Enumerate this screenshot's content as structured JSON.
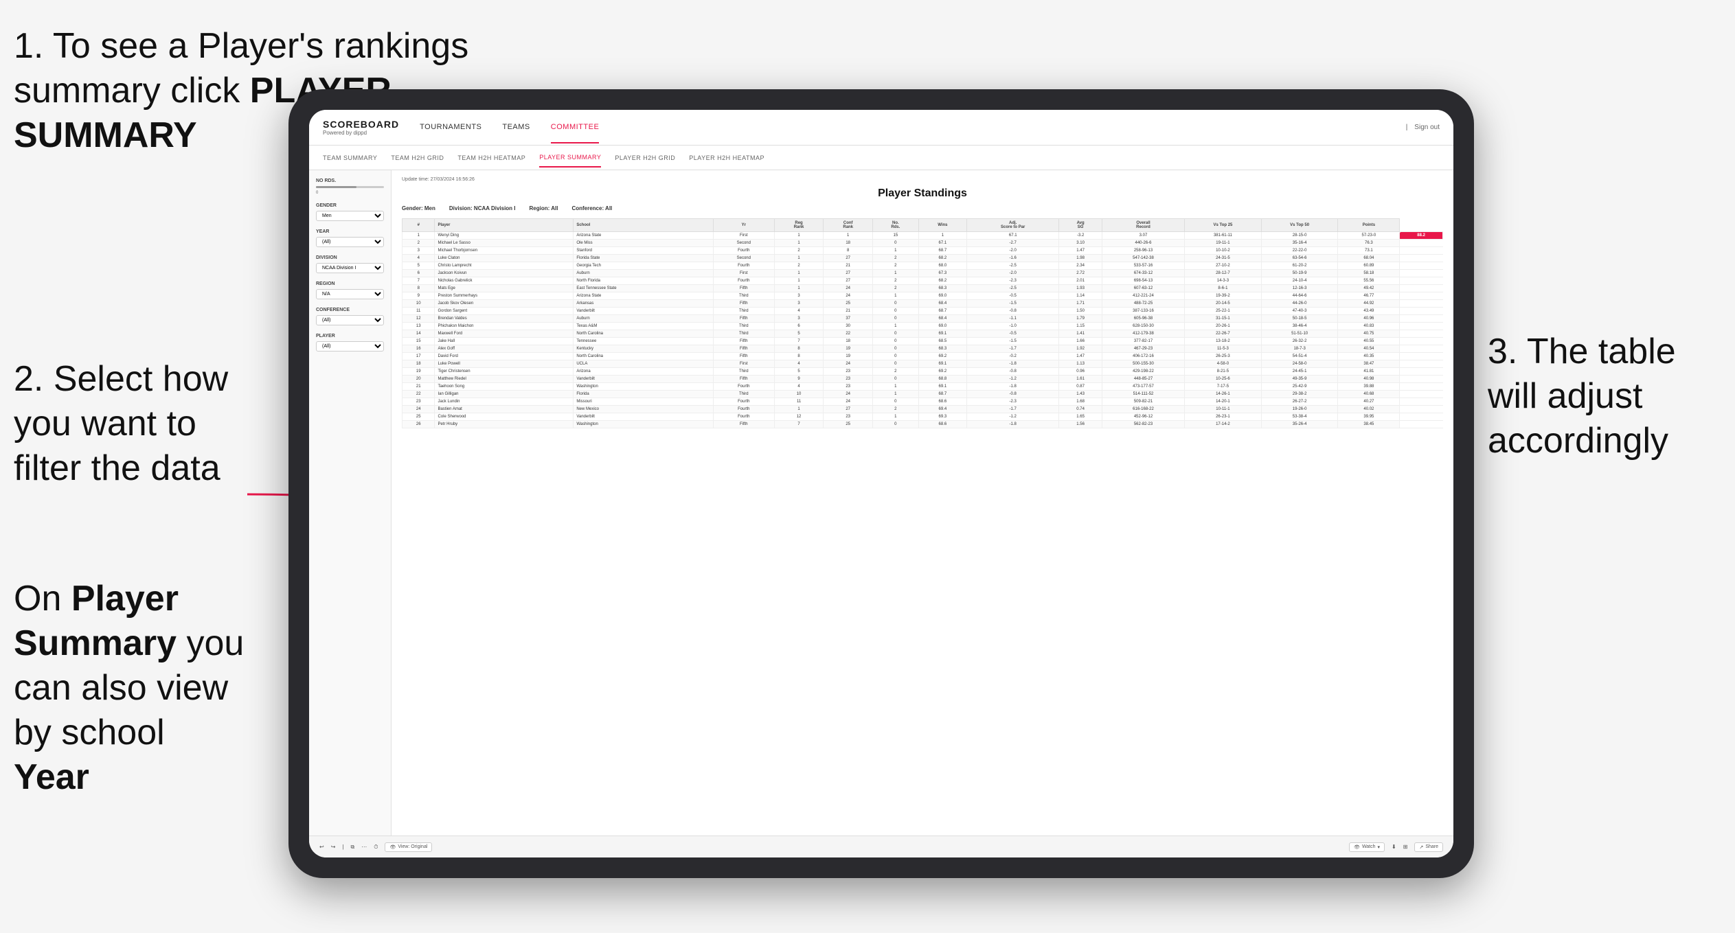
{
  "instructions": {
    "step1_line1": "1. To see a Player's rankings",
    "step1_line2": "summary click ",
    "step1_bold": "PLAYER SUMMARY",
    "step2_line1": "2. Select how",
    "step2_line2": "you want to",
    "step2_line3": "filter the data",
    "step3": "3. The table will adjust accordingly",
    "note_prefix": "On ",
    "note_bold": "Player Summary",
    "note_suffix": " you can also view by school ",
    "note_bold2": "Year"
  },
  "app": {
    "logo": "SCOREBOARD",
    "logo_sub": "Powered by dippd",
    "nav": [
      "TOURNAMENTS",
      "TEAMS",
      "COMMITTEE"
    ],
    "nav_active": "COMMITTEE",
    "sign_out": "Sign out",
    "sub_nav": [
      "TEAM SUMMARY",
      "TEAM H2H GRID",
      "TEAM H2H HEATMAP",
      "PLAYER SUMMARY",
      "PLAYER H2H GRID",
      "PLAYER H2H HEATMAP"
    ],
    "sub_nav_active": "PLAYER SUMMARY"
  },
  "filters": {
    "no_rds_label": "No Rds.",
    "gender_label": "Gender",
    "gender_value": "Men",
    "year_label": "Year",
    "year_value": "(All)",
    "division_label": "Division",
    "division_value": "NCAA Division I",
    "region_label": "Region",
    "region_value": "N/A",
    "conference_label": "Conference",
    "conference_value": "(All)",
    "player_label": "Player",
    "player_value": "(All)"
  },
  "standings": {
    "title": "Player Standings",
    "update_time": "Update time: 27/03/2024 16:56:26",
    "gender": "Gender: Men",
    "division": "Division: NCAA Division I",
    "region": "Region: All",
    "conference": "Conference: All"
  },
  "table": {
    "headers": [
      "#",
      "Player",
      "School",
      "Yr",
      "Reg Rank",
      "Conf Rank",
      "No. Rds.",
      "Wins",
      "Adj. Score to Par",
      "Avg SG",
      "Overall Record",
      "Vs Top 25",
      "Vs Top 50",
      "Points"
    ],
    "rows": [
      [
        "1",
        "Wenyi Ding",
        "Arizona State",
        "First",
        "1",
        "1",
        "15",
        "1",
        "67.1",
        "-3.2",
        "3.07",
        "381-61-11",
        "28-15-0",
        "57-23-0",
        "88.2"
      ],
      [
        "2",
        "Michael Le Sasso",
        "Ole Miss",
        "Second",
        "1",
        "18",
        "0",
        "67.1",
        "-2.7",
        "3.10",
        "440-26-6",
        "19-11-1",
        "35-16-4",
        "76.3"
      ],
      [
        "3",
        "Michael Thorbjornsen",
        "Stanford",
        "Fourth",
        "2",
        "8",
        "1",
        "68.7",
        "-2.0",
        "1.47",
        "258-96-13",
        "10-10-2",
        "22-22-0",
        "73.1"
      ],
      [
        "4",
        "Luke Claton",
        "Florida State",
        "Second",
        "1",
        "27",
        "2",
        "68.2",
        "-1.6",
        "1.98",
        "547-142-38",
        "24-31-5",
        "63-54-6",
        "68.04"
      ],
      [
        "5",
        "Christo Lamprecht",
        "Georgia Tech",
        "Fourth",
        "2",
        "21",
        "2",
        "68.0",
        "-2.5",
        "2.34",
        "533-57-16",
        "27-10-2",
        "61-20-2",
        "60.89"
      ],
      [
        "6",
        "Jackson Koivun",
        "Auburn",
        "First",
        "1",
        "27",
        "1",
        "67.3",
        "-2.0",
        "2.72",
        "674-33-12",
        "28-12-7",
        "50-19-9",
        "58.18"
      ],
      [
        "7",
        "Nicholas Gabrelick",
        "North Florida",
        "Fourth",
        "1",
        "27",
        "2",
        "68.2",
        "-2.3",
        "2.01",
        "698-54-13",
        "14-3-3",
        "24-10-4",
        "55.56"
      ],
      [
        "8",
        "Mats Ege",
        "East Tennessee State",
        "Fifth",
        "1",
        "24",
        "2",
        "68.3",
        "-2.5",
        "1.93",
        "607-63-12",
        "8-6-1",
        "12-16-3",
        "49.42"
      ],
      [
        "9",
        "Preston Summerhays",
        "Arizona State",
        "Third",
        "3",
        "24",
        "1",
        "69.0",
        "-0.5",
        "1.14",
        "412-221-24",
        "19-39-2",
        "44-64-6",
        "46.77"
      ],
      [
        "10",
        "Jacob Skov Olesen",
        "Arkansas",
        "Fifth",
        "3",
        "25",
        "0",
        "68.4",
        "-1.5",
        "1.71",
        "488-72-25",
        "20-14-5",
        "44-26-0",
        "44.92"
      ],
      [
        "11",
        "Gordon Sargent",
        "Vanderbilt",
        "Third",
        "4",
        "21",
        "0",
        "68.7",
        "-0.8",
        "1.50",
        "387-133-16",
        "25-22-1",
        "47-40-3",
        "43.49"
      ],
      [
        "12",
        "Brendan Valdes",
        "Auburn",
        "Fifth",
        "3",
        "37",
        "0",
        "68.4",
        "-1.1",
        "1.79",
        "605-96-38",
        "31-15-1",
        "50-18-5",
        "40.96"
      ],
      [
        "13",
        "Phichaksn Maichon",
        "Texas A&M",
        "Third",
        "6",
        "30",
        "1",
        "69.0",
        "-1.0",
        "1.15",
        "628-150-30",
        "20-26-1",
        "38-46-4",
        "40.83"
      ],
      [
        "14",
        "Maxwell Ford",
        "North Carolina",
        "Third",
        "5",
        "22",
        "0",
        "69.1",
        "-0.5",
        "1.41",
        "412-179-38",
        "22-26-7",
        "51-51-10",
        "40.75"
      ],
      [
        "15",
        "Jake Hall",
        "Tennessee",
        "Fifth",
        "7",
        "18",
        "0",
        "68.5",
        "-1.5",
        "1.66",
        "377-82-17",
        "13-18-2",
        "26-32-2",
        "40.55"
      ],
      [
        "16",
        "Alex Goff",
        "Kentucky",
        "Fifth",
        "8",
        "19",
        "0",
        "68.3",
        "-1.7",
        "1.92",
        "467-29-23",
        "11-5-3",
        "18-7-3",
        "40.54"
      ],
      [
        "17",
        "David Ford",
        "North Carolina",
        "Fifth",
        "8",
        "19",
        "0",
        "69.2",
        "-0.2",
        "1.47",
        "406-172-16",
        "26-25-3",
        "54-51-4",
        "40.35"
      ],
      [
        "18",
        "Luke Powell",
        "UCLA",
        "First",
        "4",
        "24",
        "0",
        "69.1",
        "-1.8",
        "1.13",
        "500-155-30",
        "4-58-0",
        "24-58-0",
        "38.47"
      ],
      [
        "19",
        "Tiger Christensen",
        "Arizona",
        "Third",
        "5",
        "23",
        "2",
        "69.2",
        "-0.8",
        "0.96",
        "429-198-22",
        "8-21-5",
        "24-45-1",
        "41.81"
      ],
      [
        "20",
        "Matthew Riedel",
        "Vanderbilt",
        "Fifth",
        "9",
        "23",
        "0",
        "68.8",
        "-1.2",
        "1.61",
        "448-85-27",
        "10-25-6",
        "49-35-9",
        "40.98"
      ],
      [
        "21",
        "Taehoon Song",
        "Washington",
        "Fourth",
        "4",
        "23",
        "1",
        "69.1",
        "-1.8",
        "0.87",
        "473-177-57",
        "7-17-5",
        "25-42-9",
        "39.88"
      ],
      [
        "22",
        "Ian Gilligan",
        "Florida",
        "Third",
        "10",
        "24",
        "1",
        "68.7",
        "-0.8",
        "1.43",
        "514-111-52",
        "14-26-1",
        "29-38-2",
        "40.68"
      ],
      [
        "23",
        "Jack Lundin",
        "Missouri",
        "Fourth",
        "11",
        "24",
        "0",
        "68.6",
        "-2.3",
        "1.68",
        "509-82-21",
        "14-20-1",
        "26-27-2",
        "40.27"
      ],
      [
        "24",
        "Bastien Amat",
        "New Mexico",
        "Fourth",
        "1",
        "27",
        "2",
        "69.4",
        "-1.7",
        "0.74",
        "616-168-22",
        "10-11-1",
        "19-26-0",
        "40.02"
      ],
      [
        "25",
        "Cole Sherwood",
        "Vanderbilt",
        "Fourth",
        "12",
        "23",
        "1",
        "69.3",
        "-1.2",
        "1.65",
        "452-96-12",
        "26-23-1",
        "53-38-4",
        "39.95"
      ],
      [
        "26",
        "Petr Hruby",
        "Washington",
        "Fifth",
        "7",
        "25",
        "0",
        "68.6",
        "-1.8",
        "1.56",
        "562-82-23",
        "17-14-2",
        "35-26-4",
        "38.45"
      ]
    ]
  },
  "toolbar": {
    "view_label": "View: Original",
    "watch_label": "Watch",
    "share_label": "Share"
  }
}
